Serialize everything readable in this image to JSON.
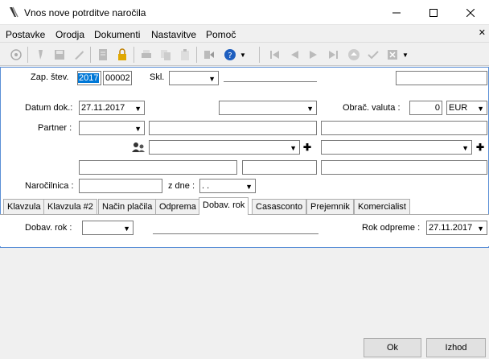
{
  "window": {
    "title": "Vnos nove potrditve naročila"
  },
  "menu": [
    "Postavke",
    "Orodja",
    "Dokumenti",
    "Nastavitve",
    "Pomoč"
  ],
  "form": {
    "zap_label": "Zap. štev.",
    "zap_year": "2017",
    "zap_number": "00002",
    "skl_label": "Skl.",
    "datum_label": "Datum dok.:",
    "datum_value": "27.11.2017",
    "valuta_label": "Obrač. valuta :",
    "valuta_amount": "0",
    "valuta_currency": "EUR",
    "partner_label": "Partner :",
    "narocilnica_label": "Naročilnica :",
    "zdne_label": "z dne :",
    "zdne_value": ". ."
  },
  "tabs": [
    "Klavzula",
    "Klavzula #2",
    "Način plačila",
    "Odprema",
    "Dobav. rok",
    "Casasconto",
    "Prejemnik",
    "Komercialist"
  ],
  "active_tab": "Dobav. rok",
  "tab_content": {
    "dobav_label": "Dobav. rok :",
    "rok_label": "Rok odpreme :",
    "rok_value": "27.11.2017"
  },
  "buttons": {
    "ok": "Ok",
    "exit": "Izhod"
  },
  "colors": {
    "accent": "#0078d7",
    "panel_border": "#5b8fd6"
  }
}
